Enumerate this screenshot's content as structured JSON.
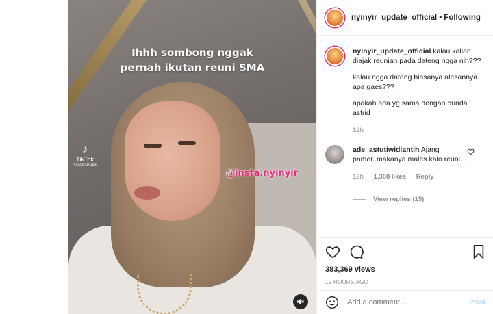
{
  "header": {
    "username": "nyinyir_update_official",
    "separator": "•",
    "follow_status": "Following"
  },
  "video": {
    "caption_line1": "Ihhh sombong nggak",
    "caption_line2": "pernah ikutan reuni SMA",
    "watermark": "@insta.nyinyir",
    "tiktok_label": "TikTok",
    "tiktok_handle": "@astridkuya"
  },
  "post": {
    "username": "nyinyir_update_official",
    "text_p1": "kalau kalian diajak reunian pada dateng ngga nih???",
    "text_p2": "kalau ngga dateng biasanya alesannya apa gaes???",
    "text_p3": "apakah ada yg sama dengan bunda astrid",
    "time": "12h"
  },
  "comment": {
    "username": "ade_astutiwidiantih",
    "text": "Ajang pamer..makanya males kalo reuni....",
    "time": "12h",
    "likes": "1,308 likes",
    "reply": "Reply",
    "view_replies": "View replies (15)"
  },
  "stats": {
    "views": "383,369 views",
    "posted": "12 HOURS AGO"
  },
  "composer": {
    "placeholder": "Add a comment…",
    "post_label": "Post"
  },
  "icons": [
    "mute-icon",
    "heart-icon",
    "comment-icon",
    "bookmark-icon",
    "emoji-icon",
    "small-heart-icon"
  ],
  "colors": {
    "watermark": "#e0307a",
    "story_ring": "#e1306c",
    "muted_text": "#8e8e8e",
    "post_disabled": "#b2dffc"
  }
}
